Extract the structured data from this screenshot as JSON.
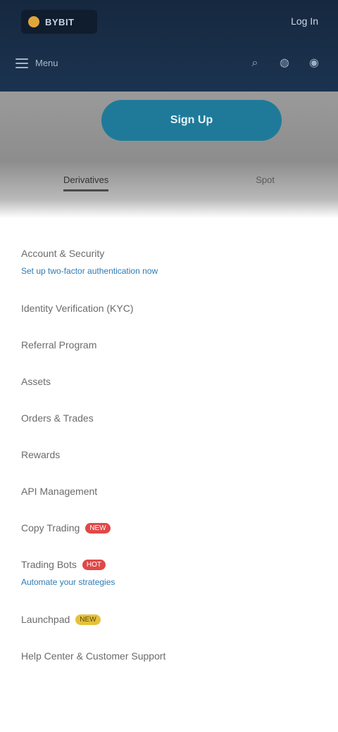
{
  "header": {
    "logo_text": "BYBIT",
    "login_label": "Log In",
    "menu_label": "Menu",
    "icons": [
      "search-icon",
      "globe-icon",
      "user-icon"
    ]
  },
  "cta": {
    "label": "Sign Up"
  },
  "tabs": [
    {
      "label": "Derivatives"
    },
    {
      "label": "Spot"
    }
  ],
  "list": [
    {
      "label": "Account & Security",
      "sub": "Set up two-factor authentication now"
    },
    {
      "label": "Identity Verification (KYC)"
    },
    {
      "label": "Referral Program"
    },
    {
      "label": "Assets"
    },
    {
      "label": "Orders & Trades"
    },
    {
      "label": "Rewards"
    },
    {
      "label": "API Management"
    },
    {
      "label": "Copy Trading",
      "badge": "NEW"
    },
    {
      "label": "Trading Bots",
      "badge": "HOT",
      "sub": "Automate your strategies"
    },
    {
      "label": "Launchpad",
      "badge": "NEW",
      "badge_color": "yellow"
    },
    {
      "label": "Help Center & Customer Support"
    }
  ]
}
